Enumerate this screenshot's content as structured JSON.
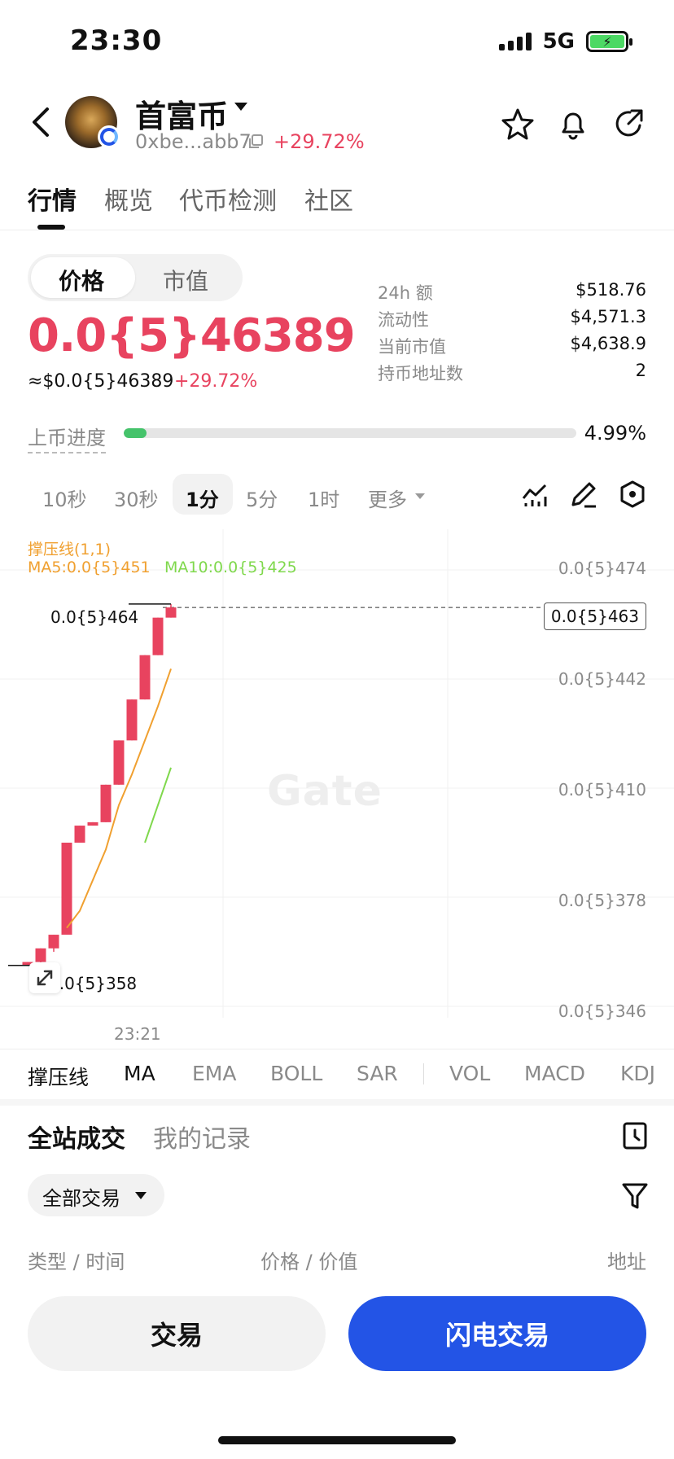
{
  "status_bar": {
    "time": "23:30",
    "network": "5G"
  },
  "header": {
    "coin_name": "首富币",
    "address": "0xbe...abb7",
    "change": "+29.72%"
  },
  "tabs": [
    {
      "label": "行情",
      "active": true
    },
    {
      "label": "概览",
      "active": false
    },
    {
      "label": "代币检测",
      "active": false
    },
    {
      "label": "社区",
      "active": false
    }
  ],
  "price_toggle": {
    "options": [
      "价格",
      "市值"
    ],
    "selected": "价格"
  },
  "price": {
    "main": "0.0{5}46389",
    "usd": "≈$0.0{5}46389",
    "change": "+29.72%"
  },
  "stats": [
    {
      "label": "24h  额",
      "value": "$518.76"
    },
    {
      "label": "流动性",
      "value": "$4,571.3"
    },
    {
      "label": "当前市值",
      "value": "$4,638.9"
    },
    {
      "label": "持币地址数",
      "value": "2"
    }
  ],
  "listing_progress": {
    "label": "上币进度",
    "percent": 4.99,
    "text": "4.99%"
  },
  "intervals": [
    {
      "label": "10秒",
      "active": false
    },
    {
      "label": "30秒",
      "active": false
    },
    {
      "label": "1分",
      "active": true
    },
    {
      "label": "5分",
      "active": false
    },
    {
      "label": "1时",
      "active": false
    },
    {
      "label": "更多",
      "active": false
    }
  ],
  "chart_data": {
    "type": "candlestick",
    "indicator_title": "撑压线(1,1)",
    "ma5": "MA5:0.0{5}451",
    "ma10": "MA10:0.0{5}425",
    "y_tick_labels": [
      "0.0{5}474",
      "0.0{5}442",
      "0.0{5}410",
      "0.0{5}378",
      "0.0{5}346"
    ],
    "y_ticks": [
      4.74,
      4.42,
      4.1,
      3.78,
      3.46
    ],
    "ylim": [
      3.46,
      4.74
    ],
    "unit_note": "values in units of 1e-6 (0.0{5}X)",
    "x_tick_label": "23:21",
    "current_price_label": "0.0{5}463",
    "current_price": 4.63,
    "high_label": "0.0{5}464",
    "low_label": "0.0{5}358",
    "watermark": "Gate",
    "candles": [
      {
        "open": 3.58,
        "close": 3.59,
        "high": 3.59,
        "low": 3.58
      },
      {
        "open": 3.59,
        "close": 3.63,
        "high": 3.63,
        "low": 3.58
      },
      {
        "open": 3.63,
        "close": 3.67,
        "high": 3.67,
        "low": 3.62
      },
      {
        "open": 3.67,
        "close": 3.94,
        "high": 3.94,
        "low": 3.67
      },
      {
        "open": 3.94,
        "close": 3.99,
        "high": 3.99,
        "low": 3.94
      },
      {
        "open": 3.99,
        "close": 4.0,
        "high": 4.0,
        "low": 3.99
      },
      {
        "open": 4.0,
        "close": 4.11,
        "high": 4.11,
        "low": 4.0
      },
      {
        "open": 4.11,
        "close": 4.24,
        "high": 4.24,
        "low": 4.11
      },
      {
        "open": 4.24,
        "close": 4.36,
        "high": 4.36,
        "low": 4.24
      },
      {
        "open": 4.36,
        "close": 4.49,
        "high": 4.49,
        "low": 4.36
      },
      {
        "open": 4.49,
        "close": 4.6,
        "high": 4.6,
        "low": 4.49
      },
      {
        "open": 4.6,
        "close": 4.63,
        "high": 4.64,
        "low": 4.6
      }
    ],
    "ma5_line": [
      null,
      null,
      null,
      3.69,
      3.74,
      3.83,
      3.92,
      4.05,
      4.14,
      4.24,
      4.34,
      4.45
    ],
    "ma10_line": [
      null,
      null,
      null,
      null,
      null,
      null,
      null,
      null,
      null,
      3.94,
      4.05,
      4.16
    ],
    "colors": {
      "up": "#e8435f",
      "ma5": "#f0a030",
      "ma10": "#7fd84c"
    }
  },
  "indicators": [
    {
      "label": "撑压线",
      "active": true
    },
    {
      "label": "MA",
      "active": true
    },
    {
      "label": "EMA",
      "active": false
    },
    {
      "label": "BOLL",
      "active": false
    },
    {
      "label": "SAR",
      "active": false
    },
    {
      "label": "VOL",
      "active": false
    },
    {
      "label": "MACD",
      "active": false
    },
    {
      "label": "KDJ",
      "active": false
    }
  ],
  "trades": {
    "tabs": [
      "全站成交",
      "我的记录"
    ],
    "filter": "全部交易",
    "columns": [
      "类型 / 时间",
      "价格 / 价值",
      "地址"
    ]
  },
  "actions": {
    "trade": "交易",
    "flash_trade": "闪电交易"
  },
  "colors": {
    "accent_red": "#e8435f",
    "primary_blue": "#2354e6",
    "progress_green": "#45c36b"
  }
}
